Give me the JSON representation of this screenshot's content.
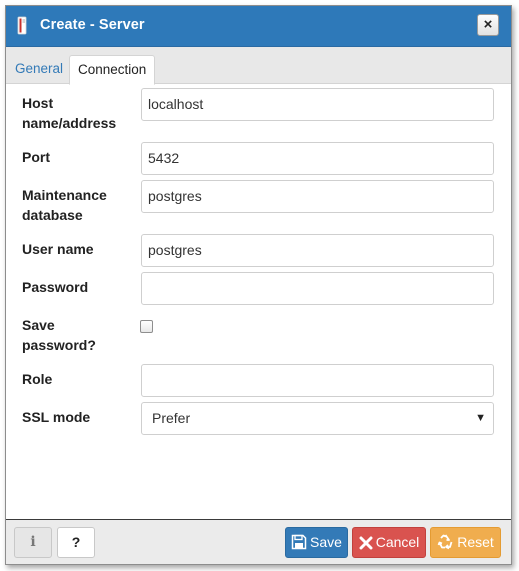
{
  "window": {
    "title": "Create - Server",
    "close_symbol": "×"
  },
  "tabs": [
    {
      "label": "General",
      "active": false
    },
    {
      "label": "Connection",
      "active": true
    }
  ],
  "form": {
    "host": {
      "label_line1": "Host",
      "label_line2": "name/address",
      "value": "localhost"
    },
    "port": {
      "label": "Port",
      "value": "5432"
    },
    "maintenance_db": {
      "label_line1": "Maintenance",
      "label_line2": "database",
      "value": "postgres"
    },
    "username": {
      "label": "User name",
      "value": "postgres"
    },
    "password": {
      "label": "Password",
      "value": ""
    },
    "save_password": {
      "label_line1": "Save",
      "label_line2": "password?",
      "checked": false
    },
    "role": {
      "label": "Role",
      "value": ""
    },
    "ssl_mode": {
      "label": "SSL mode",
      "selected": "Prefer"
    }
  },
  "footer": {
    "info_symbol": "i",
    "help_symbol": "?",
    "save_label": "Save",
    "cancel_label": "Cancel",
    "reset_label": "Reset"
  },
  "colors": {
    "titlebar": "#2e79b9",
    "save": "#337ab7",
    "cancel": "#d9534f",
    "reset": "#f0ad4e",
    "tab_link": "#337ab7"
  },
  "icons": {
    "title": "server-icon",
    "save": "floppy-disk-icon",
    "cancel": "x-icon",
    "reset": "recycle-icon"
  }
}
